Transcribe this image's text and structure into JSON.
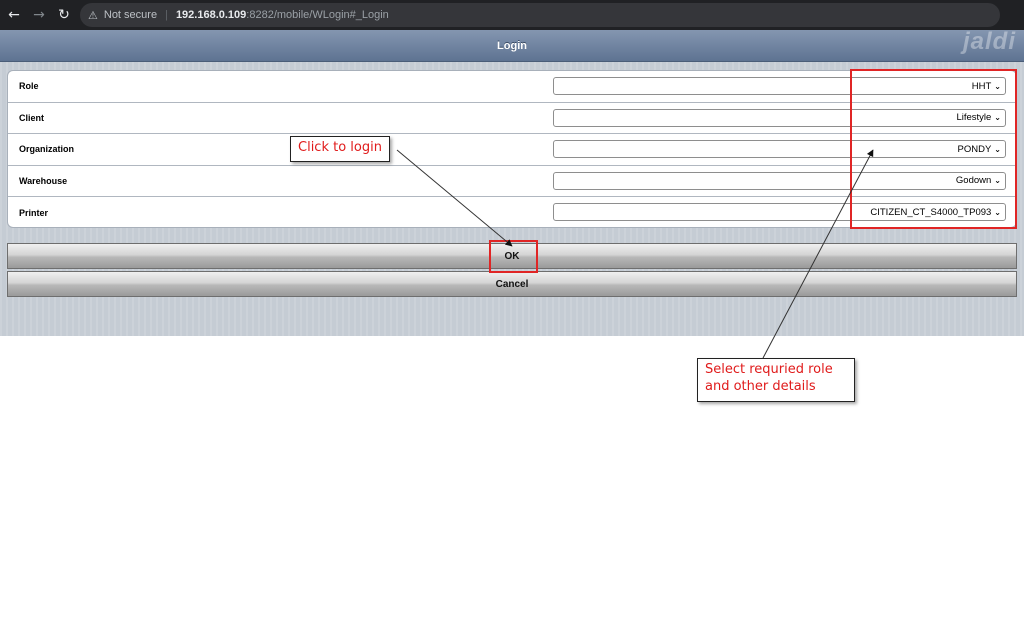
{
  "browser": {
    "back_icon": "back-arrow-icon",
    "forward_icon": "forward-arrow-icon",
    "reload_icon": "reload-icon",
    "security_label": "Not secure",
    "url_host": "192.168.0.109",
    "url_rest": ":8282/mobile/WLogin#_Login"
  },
  "app": {
    "title": "Login",
    "logo_text": "jaldi"
  },
  "form": {
    "fields": [
      {
        "label": "Role",
        "value": "HHT"
      },
      {
        "label": "Client",
        "value": "Lifestyle"
      },
      {
        "label": "Organization",
        "value": "PONDY"
      },
      {
        "label": "Warehouse",
        "value": "Godown"
      },
      {
        "label": "Printer",
        "value": "CITIZEN_CT_S4000_TP093"
      }
    ]
  },
  "buttons": {
    "ok_label": "OK",
    "cancel_label": "Cancel"
  },
  "annotations": {
    "login_note": "Click to login",
    "role_note_line1": "Select requried role",
    "role_note_line2": "and other details",
    "highlight_color": "#e02525",
    "note_text_color": "#e01b1b"
  },
  "colors": {
    "header_top": "#8496b0",
    "header_bottom": "#5e7392",
    "content_bg": "#c5ccd4"
  }
}
